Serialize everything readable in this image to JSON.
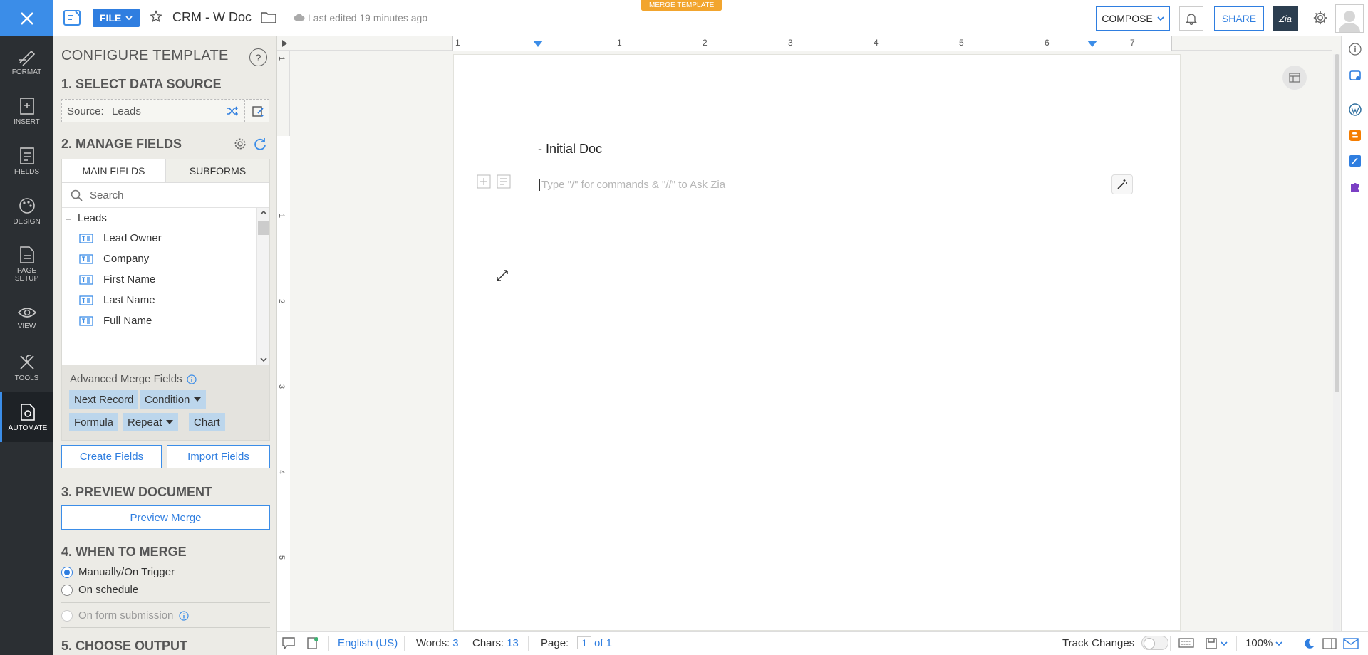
{
  "topbar": {
    "file_label": "FILE",
    "doc_title": "CRM - W Doc",
    "last_edited": "Last edited 19 minutes ago",
    "merge_badge": "MERGE TEMPLATE",
    "compose_label": "COMPOSE",
    "share_label": "SHARE",
    "zia_label": "Zia"
  },
  "rail": {
    "items": [
      {
        "label": "FORMAT",
        "icon": "format-icon"
      },
      {
        "label": "INSERT",
        "icon": "insert-icon"
      },
      {
        "label": "FIELDS",
        "icon": "fields-icon"
      },
      {
        "label": "DESIGN",
        "icon": "design-icon"
      },
      {
        "label": "PAGE SETUP",
        "icon": "page-setup-icon"
      },
      {
        "label": "VIEW",
        "icon": "view-icon"
      },
      {
        "label": "TOOLS",
        "icon": "tools-icon"
      },
      {
        "label": "AUTOMATE",
        "icon": "automate-icon"
      }
    ],
    "active": "AUTOMATE"
  },
  "panel": {
    "title": "CONFIGURE TEMPLATE",
    "sec1": "1. SELECT DATA SOURCE",
    "source_label": "Source:",
    "source_value": "Leads",
    "sec2": "2. MANAGE FIELDS",
    "tabs": [
      "MAIN FIELDS",
      "SUBFORMS"
    ],
    "search_placeholder": "Search",
    "group": "Leads",
    "fields": [
      "Lead Owner",
      "Company",
      "First Name",
      "Last Name",
      "Full Name"
    ],
    "advanced_title": "Advanced Merge Fields",
    "chips": {
      "next_record": "Next Record",
      "condition": "Condition",
      "formula": "Formula",
      "repeat": "Repeat",
      "chart": "Chart"
    },
    "create_fields": "Create Fields",
    "import_fields": "Import Fields",
    "sec3": "3. PREVIEW DOCUMENT",
    "preview_merge": "Preview Merge",
    "sec4": "4. WHEN TO MERGE",
    "radio_manual": "Manually/On Trigger",
    "radio_schedule": "On schedule",
    "radio_form": "On form submission",
    "sec5": "5. CHOOSE OUTPUT"
  },
  "ruler": {
    "h_labels": [
      "1",
      "1",
      "2",
      "3",
      "4",
      "5",
      "6",
      "7"
    ],
    "v_labels": [
      "1",
      "1",
      "2",
      "3",
      "4",
      "5"
    ]
  },
  "editor": {
    "heading": "- Initial Doc",
    "placeholder": "Type \"/\" for commands & \"//\" to Ask Zia"
  },
  "statusbar": {
    "language": "English (US)",
    "words_label": "Words:",
    "words_value": "3",
    "chars_label": "Chars:",
    "chars_value": "13",
    "page_label": "Page:",
    "page_value": "1",
    "page_of": "of 1",
    "track_changes": "Track Changes",
    "zoom": "100%"
  },
  "colors": {
    "accent": "#3b8de8",
    "rail_bg": "#2b2f33",
    "merge_badge": "#f2a52e",
    "chip_bg": "#bcd6ec"
  }
}
